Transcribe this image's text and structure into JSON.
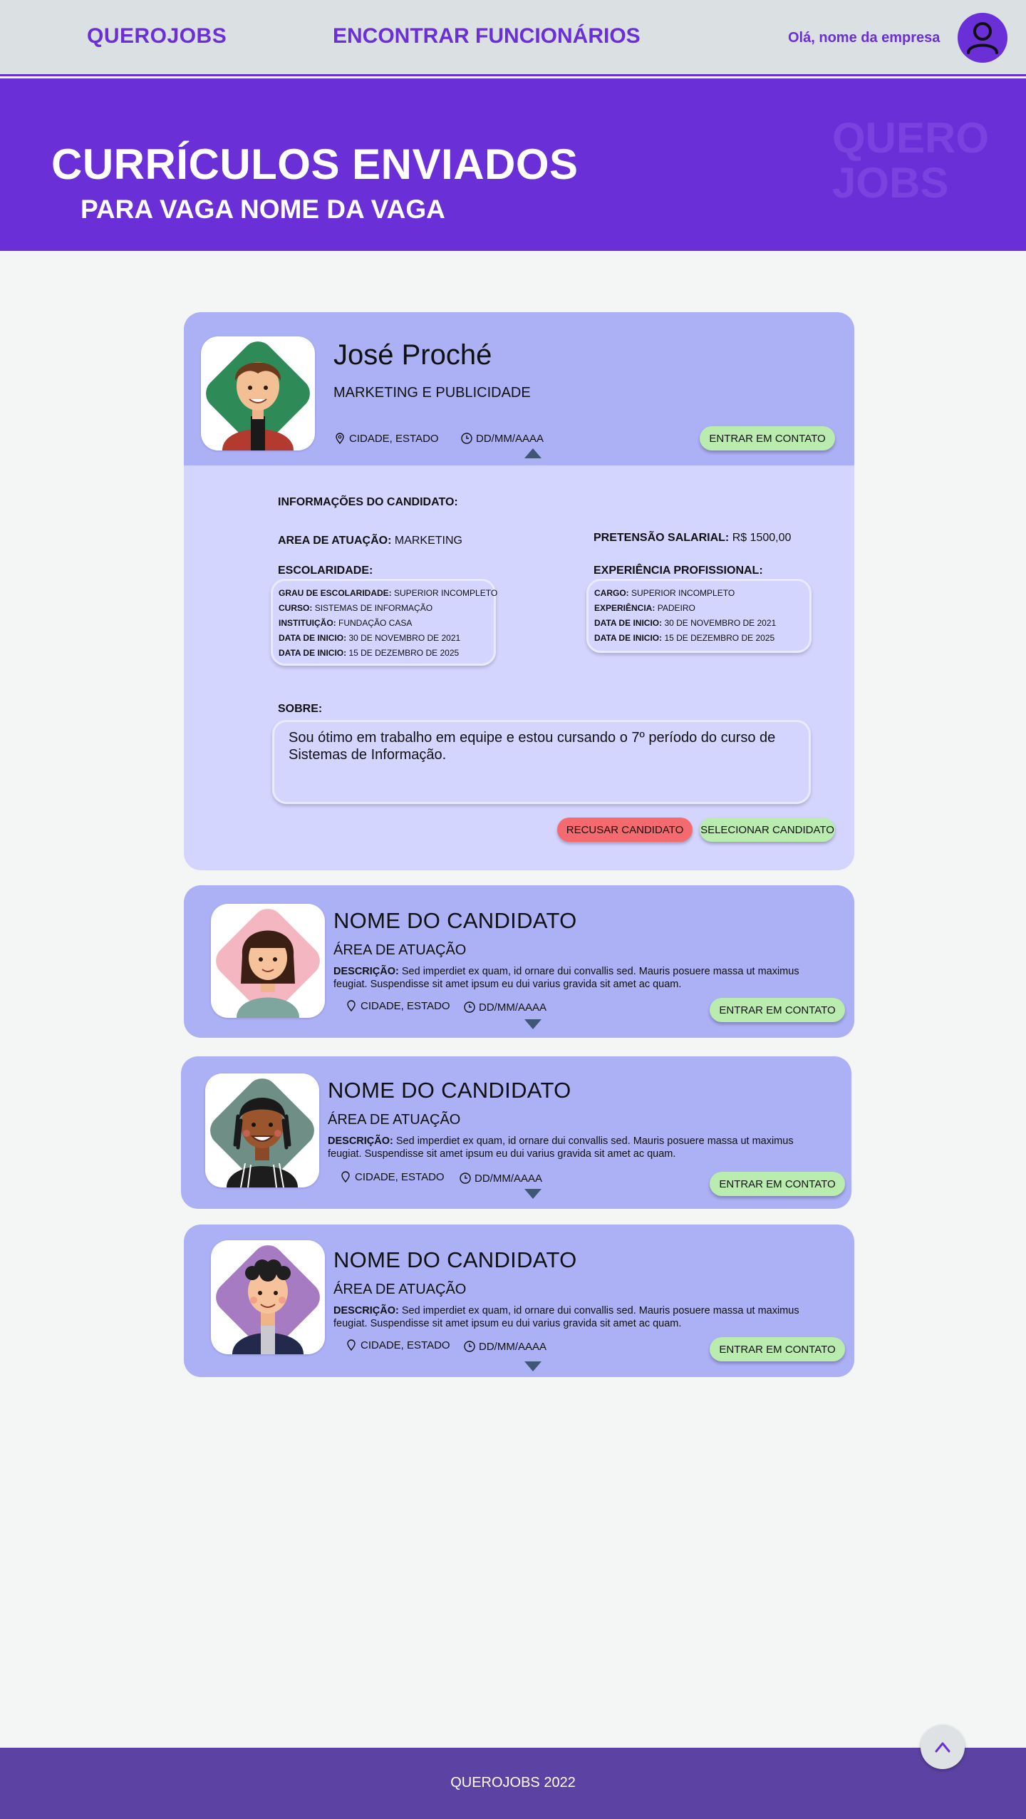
{
  "header": {
    "brand": "QUEROJOBS",
    "nav_link": "ENCONTRAR FUNCIONÁRIOS",
    "greeting": "Olá, nome da empresa"
  },
  "hero": {
    "title": "CURRÍCULOS ENVIADOS",
    "subtitle": "PARA VAGA NOME DA VAGA",
    "watermark_line1": "QUERO",
    "watermark_line2": "JOBS"
  },
  "expanded_candidate": {
    "name": "José Proché",
    "area": "MARKETING E PUBLICIDADE",
    "location": "CIDADE, ESTADO",
    "date": "DD/MM/AAAA",
    "contact_button": "ENTRAR EM CONTATO",
    "info_title": "INFORMAÇÕES DO CANDIDATO:",
    "area_label": "AREA DE ATUAÇÃO:",
    "area_value": "MARKETING",
    "salary_label": "PRETENSÃO SALARIAL:",
    "salary_value": "R$ 1500,00",
    "education_title": "ESCOLARIDADE:",
    "education": [
      {
        "label": "GRAU DE ESCOLARIDADE:",
        "value": "SUPERIOR INCOMPLETO"
      },
      {
        "label": "CURSO:",
        "value": "SISTEMAS DE INFORMAÇÃO"
      },
      {
        "label": "INSTITUIÇÃO:",
        "value": "FUNDAÇÃO CASA"
      },
      {
        "label": "DATA DE INICIO:",
        "value": "30 DE NOVEMBRO DE 2021"
      },
      {
        "label": "DATA DE INICIO:",
        "value": "15 DE DEZEMBRO DE 2025"
      }
    ],
    "experience_title": "EXPERIÊNCIA PROFISSIONAL:",
    "experience": [
      {
        "label": "CARGO:",
        "value": "SUPERIOR INCOMPLETO"
      },
      {
        "label": "EXPERIÊNCIA:",
        "value": "PADEIRO"
      },
      {
        "label": "DATA DE INICIO:",
        "value": "30 DE NOVEMBRO DE 2021"
      },
      {
        "label": "DATA DE INICIO:",
        "value": "15 DE DEZEMBRO DE 2025"
      }
    ],
    "about_title": "SOBRE:",
    "about_text": "Sou ótimo em trabalho em equipe e estou cursando o 7º período do curso de Sistemas de Informação.",
    "reject_button": "RECUSAR CANDIDATO",
    "select_button": "SELECIONAR CANDIDATO"
  },
  "candidates": [
    {
      "name": "NOME DO CANDIDATO",
      "area": "ÁREA DE ATUAÇÃO",
      "desc_label": "DESCRIÇÃO:",
      "desc_text": "Sed imperdiet ex quam, id ornare dui convallis sed. Mauris posuere massa ut maximus feugiat. Suspendisse sit amet ipsum eu dui varius gravida sit amet ac quam.",
      "location": "CIDADE, ESTADO",
      "date": "DD/MM/AAAA",
      "contact_button": "ENTRAR EM CONTATO"
    },
    {
      "name": "NOME DO CANDIDATO",
      "area": "ÁREA DE ATUAÇÃO",
      "desc_label": "DESCRIÇÃO:",
      "desc_text": "Sed imperdiet ex quam, id ornare dui convallis sed. Mauris posuere massa ut maximus feugiat. Suspendisse sit amet ipsum eu dui varius gravida sit amet ac quam.",
      "location": "CIDADE, ESTADO",
      "date": "DD/MM/AAAA",
      "contact_button": "ENTRAR EM CONTATO"
    },
    {
      "name": "NOME DO CANDIDATO",
      "area": "ÁREA DE ATUAÇÃO",
      "desc_label": "DESCRIÇÃO:",
      "desc_text": "Sed imperdiet ex quam, id ornare dui convallis sed. Mauris posuere massa ut maximus feugiat. Suspendisse sit amet ipsum eu dui varius gravida sit amet ac quam.",
      "location": "CIDADE, ESTADO",
      "date": "DD/MM/AAAA",
      "contact_button": "ENTRAR EM CONTATO"
    }
  ],
  "footer": {
    "text": "QUEROJOBS 2022"
  },
  "icons": {
    "user": "user-icon",
    "location": "location-pin-icon",
    "date": "clock-icon",
    "expand": "triangle-down-icon",
    "collapse": "triangle-up-icon",
    "back_to_top": "chevron-up-icon"
  },
  "colors": {
    "brand": "#6a2fd6",
    "card": "#acb0f5",
    "card_expanded": "#d3d5ff",
    "button_green": "#b9ecae",
    "button_red": "#f46a6e",
    "footer": "#5c43a3"
  }
}
